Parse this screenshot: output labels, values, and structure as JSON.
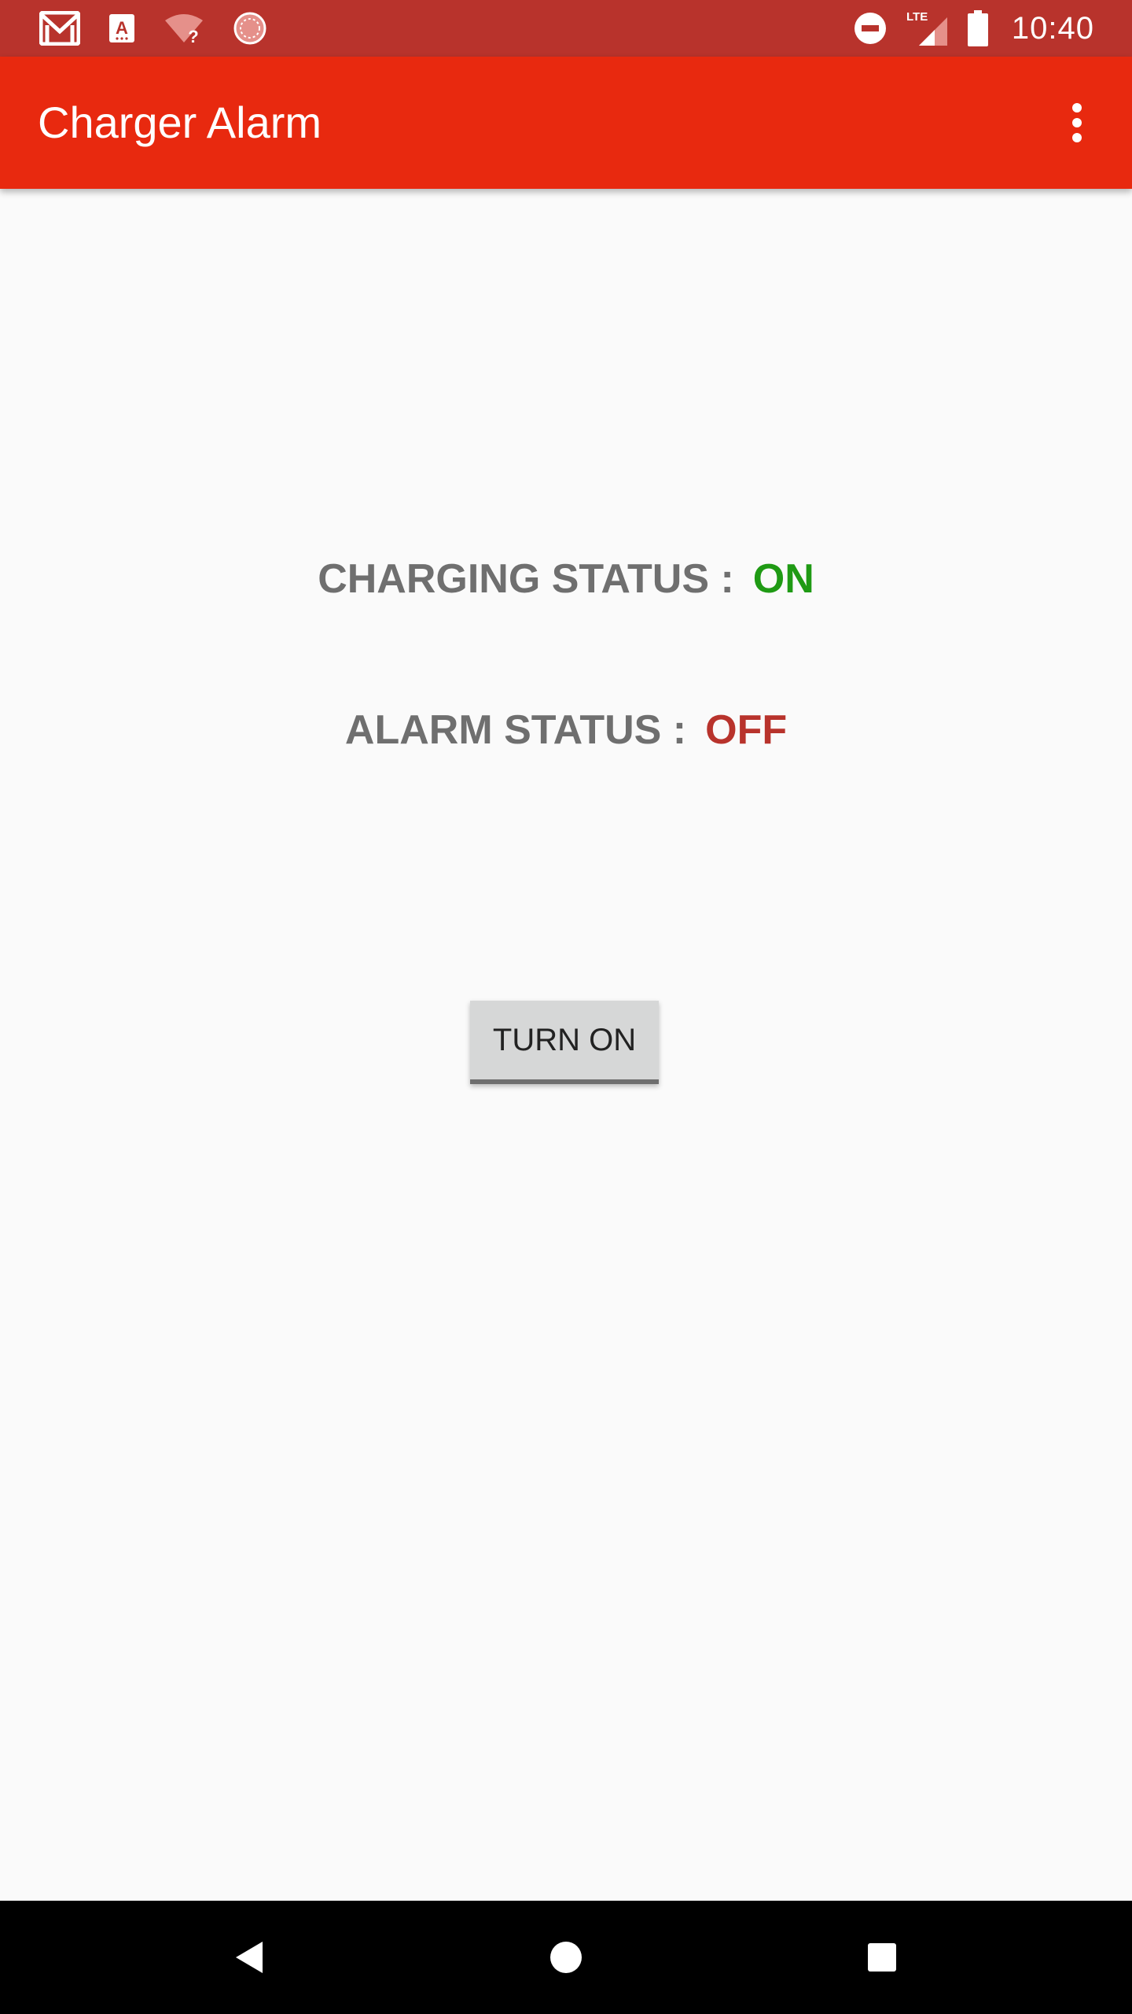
{
  "status_bar": {
    "time": "10:40",
    "network_label": "LTE",
    "notification_icons": [
      "gmail-icon",
      "translate-icon",
      "wifi-unknown-icon",
      "sync-icon"
    ],
    "system_icons": [
      "do-not-disturb-icon",
      "lte-signal-icon",
      "battery-icon"
    ],
    "background_color": "#b8332c"
  },
  "app_bar": {
    "title": "Charger Alarm",
    "menu_icon": "more-vert-icon",
    "color": "#e8290f"
  },
  "main": {
    "charging_status": {
      "label": "CHARGING STATUS :",
      "value": "ON",
      "value_color": "#1f9a14"
    },
    "alarm_status": {
      "label": "ALARM STATUS :",
      "value": "OFF",
      "value_color": "#b8332c"
    },
    "toggle_button_label": "TURN ON"
  },
  "nav_bar": {
    "buttons": [
      "back-icon",
      "home-icon",
      "recents-icon"
    ]
  }
}
